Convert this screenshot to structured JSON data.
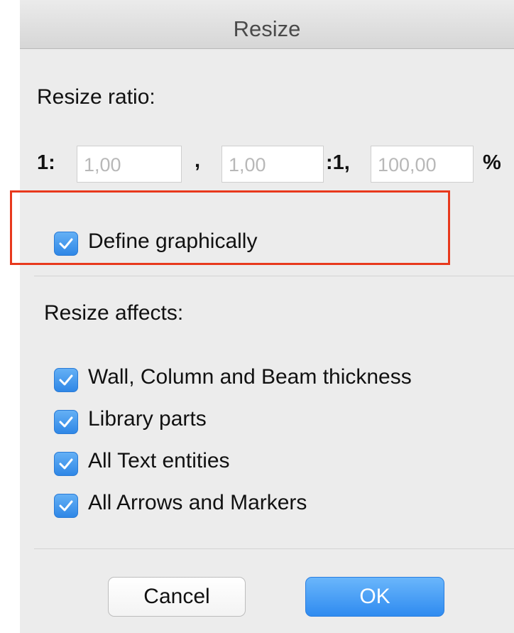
{
  "dialog": {
    "title": "Resize"
  },
  "ratio": {
    "heading": "Resize ratio:",
    "prefix": "1:",
    "field1_value": "1,00",
    "separator": ",",
    "field2_value": "1,00",
    "mid_label": ":1,",
    "percent_value": "100,00",
    "percent_sign": "%"
  },
  "define_graphically": {
    "label": "Define graphically",
    "checked": true
  },
  "affects": {
    "heading": "Resize affects:",
    "items": [
      {
        "label": "Wall, Column and Beam thickness",
        "checked": true
      },
      {
        "label": "Library parts",
        "checked": true
      },
      {
        "label": "All Text entities",
        "checked": true
      },
      {
        "label": "All Arrows and Markers",
        "checked": true
      }
    ]
  },
  "buttons": {
    "cancel": "Cancel",
    "ok": "OK"
  },
  "colors": {
    "accent": "#3a8fea",
    "highlight": "#e8391d"
  }
}
